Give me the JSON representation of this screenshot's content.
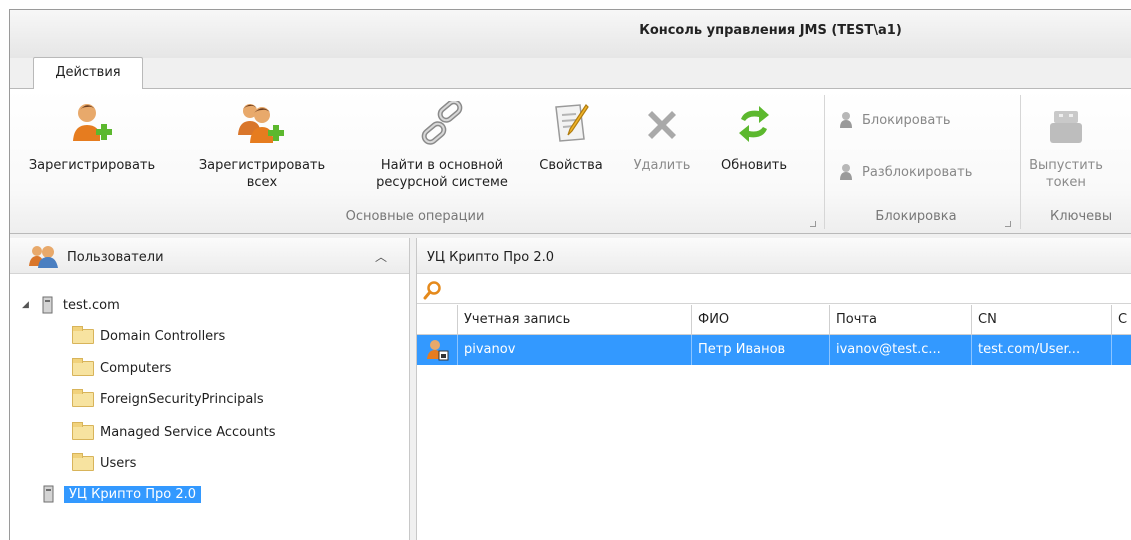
{
  "window": {
    "title": "Консоль управления JMS (TEST\\a1)"
  },
  "ribbon": {
    "tab_label": "Действия",
    "main_group": {
      "label": "Основные операции",
      "buttons": {
        "register": "Зарегистрировать",
        "register_all_1": "Зарегистрировать",
        "register_all_2": "всех",
        "find_1": "Найти в основной",
        "find_2": "ресурсной системе",
        "properties": "Свойства",
        "delete": "Удалить",
        "refresh": "Обновить"
      }
    },
    "lock_group": {
      "label": "Блокировка",
      "lock": "Блокировать",
      "unlock": "Разблокировать"
    },
    "key_group": {
      "label": "Ключевы",
      "issue_1": "Выпустить",
      "issue_2": "токен"
    }
  },
  "left_pane": {
    "header": "Пользователи",
    "tree": {
      "root": "test.com",
      "children": [
        "Domain Controllers",
        "Computers",
        "ForeignSecurityPrincipals",
        "Managed Service Accounts",
        "Users"
      ],
      "selected": "УЦ Крипто Про 2.0"
    }
  },
  "right_pane": {
    "header": "УЦ Крипто Про 2.0",
    "search_placeholder": "",
    "columns": [
      "Учетная запись",
      "ФИО",
      "Почта",
      "CN",
      "С"
    ],
    "rows": [
      {
        "account": "pivanov",
        "name": "Петр Иванов",
        "email": "ivanov@test.c...",
        "cn": "test.com/User..."
      }
    ]
  },
  "colors": {
    "selection": "#3399ff",
    "accent_green": "#5cb82e"
  }
}
